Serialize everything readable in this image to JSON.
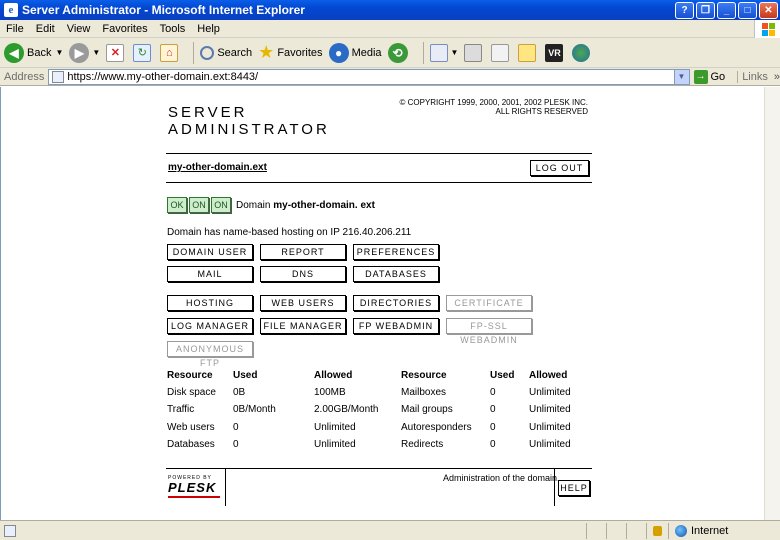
{
  "window": {
    "title": "Server Administrator - Microsoft Internet Explorer",
    "ie_icon": "e"
  },
  "menu": [
    "File",
    "Edit",
    "View",
    "Favorites",
    "Tools",
    "Help"
  ],
  "toolbar": {
    "back": "Back",
    "search": "Search",
    "favorites": "Favorites",
    "media": "Media"
  },
  "address": {
    "label": "Address",
    "url": "https://www.my-other-domain.ext:8443/",
    "go": "Go",
    "links": "Links"
  },
  "page": {
    "logo_line1": "SERVER",
    "logo_line2": "ADMINISTRATOR",
    "copyright_line1": "© COPYRIGHT 1999, 2000, 2001, 2002 PLESK INC.",
    "copyright_line2": "ALL RIGHTS RESERVED",
    "domain_link": "my-other-domain.ext",
    "logout": "LOG OUT",
    "status_ok": "OK",
    "status_on1": "ON",
    "status_on2": "ON",
    "domain_prefix": "Domain ",
    "domain_name": "my-other-domain. ext",
    "hosting_info": "Domain has name-based hosting on IP 216.40.206.211",
    "buttons": {
      "domain_user": "DOMAIN USER",
      "report": "REPORT",
      "preferences": "PREFERENCES",
      "mail": "MAIL",
      "dns": "DNS",
      "databases": "DATABASES",
      "hosting": "HOSTING",
      "web_users": "WEB USERS",
      "directories": "DIRECTORIES",
      "certificate": "CERTIFICATE",
      "log_manager": "LOG MANAGER",
      "file_manager": "FILE MANAGER",
      "fp_webadmin": "FP WEBADMIN",
      "fp_ssl_webadmin": "FP-SSL WEBADMIN",
      "anonymous_ftp": "ANONYMOUS FTP"
    },
    "resources": {
      "headers": [
        "Resource",
        "Used",
        "Allowed",
        "Resource",
        "Used",
        "Allowed"
      ],
      "rows": [
        [
          "Disk space",
          "0B",
          "100MB",
          "Mailboxes",
          "0",
          "Unlimited"
        ],
        [
          "Traffic",
          "0B/Month",
          "2.00GB/Month",
          "Mail groups",
          "0",
          "Unlimited"
        ],
        [
          "Web users",
          "0",
          "Unlimited",
          "Autoresponders",
          "0",
          "Unlimited"
        ],
        [
          "Databases",
          "0",
          "Unlimited",
          "Redirects",
          "0",
          "Unlimited"
        ]
      ]
    },
    "powered_by": "POWERED BY",
    "plesk": "PLESK",
    "footer_text": "Administration of the domain.",
    "help": "HELP"
  },
  "statusbar": {
    "zone": "Internet"
  }
}
